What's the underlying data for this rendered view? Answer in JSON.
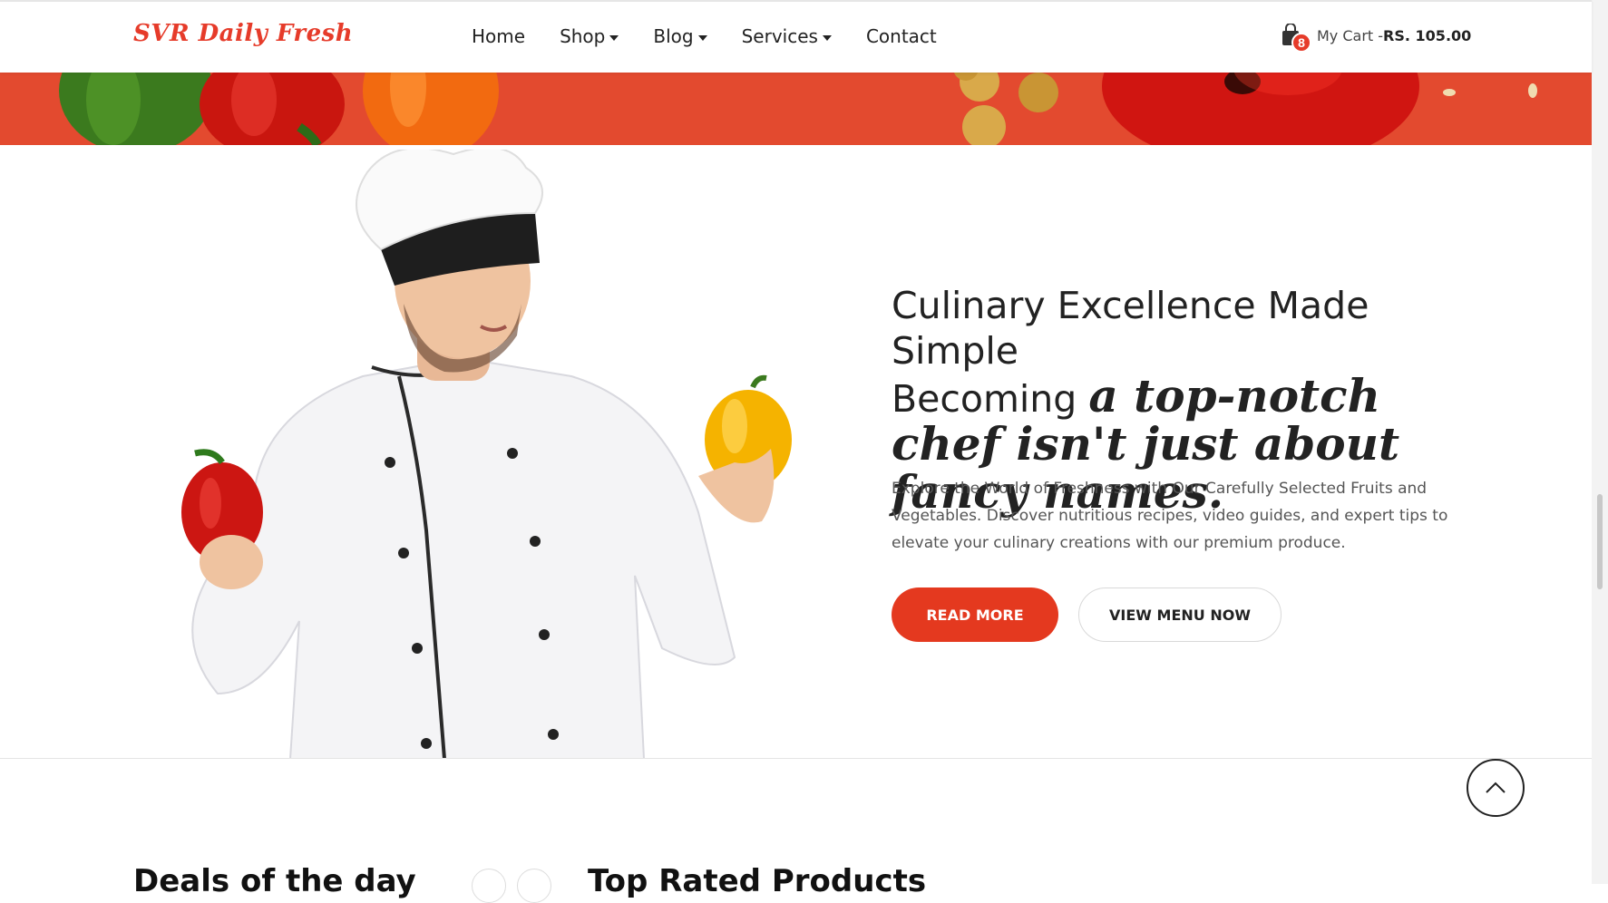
{
  "header": {
    "logo": "SVR Daily Fresh",
    "nav": [
      {
        "label": "Home",
        "dropdown": false
      },
      {
        "label": "Shop",
        "dropdown": true
      },
      {
        "label": "Blog",
        "dropdown": true
      },
      {
        "label": "Services",
        "dropdown": true
      },
      {
        "label": "Contact",
        "dropdown": false
      }
    ],
    "cart": {
      "count": "8",
      "label": "My Cart -",
      "total": "RS. 105.00"
    }
  },
  "hero": {
    "heading_line1": "Culinary Excellence Made Simple",
    "heading_line2": "Becoming",
    "heading_emphasis": "a top-notch chef isn't just about fancy names.",
    "description": "Explore the World of Freshness with Our Carefully Selected Fruits and Vegetables. Discover nutritious recipes, video guides, and expert tips to elevate your culinary creations with our premium produce.",
    "primary_button": "READ MORE",
    "secondary_button": "VIEW MENU NOW"
  },
  "sections": {
    "deals_title": "Deals of the day",
    "top_rated_title": "Top Rated Products"
  },
  "colors": {
    "accent": "#e4391f",
    "banner": "#e34a2f",
    "text": "#222222"
  }
}
